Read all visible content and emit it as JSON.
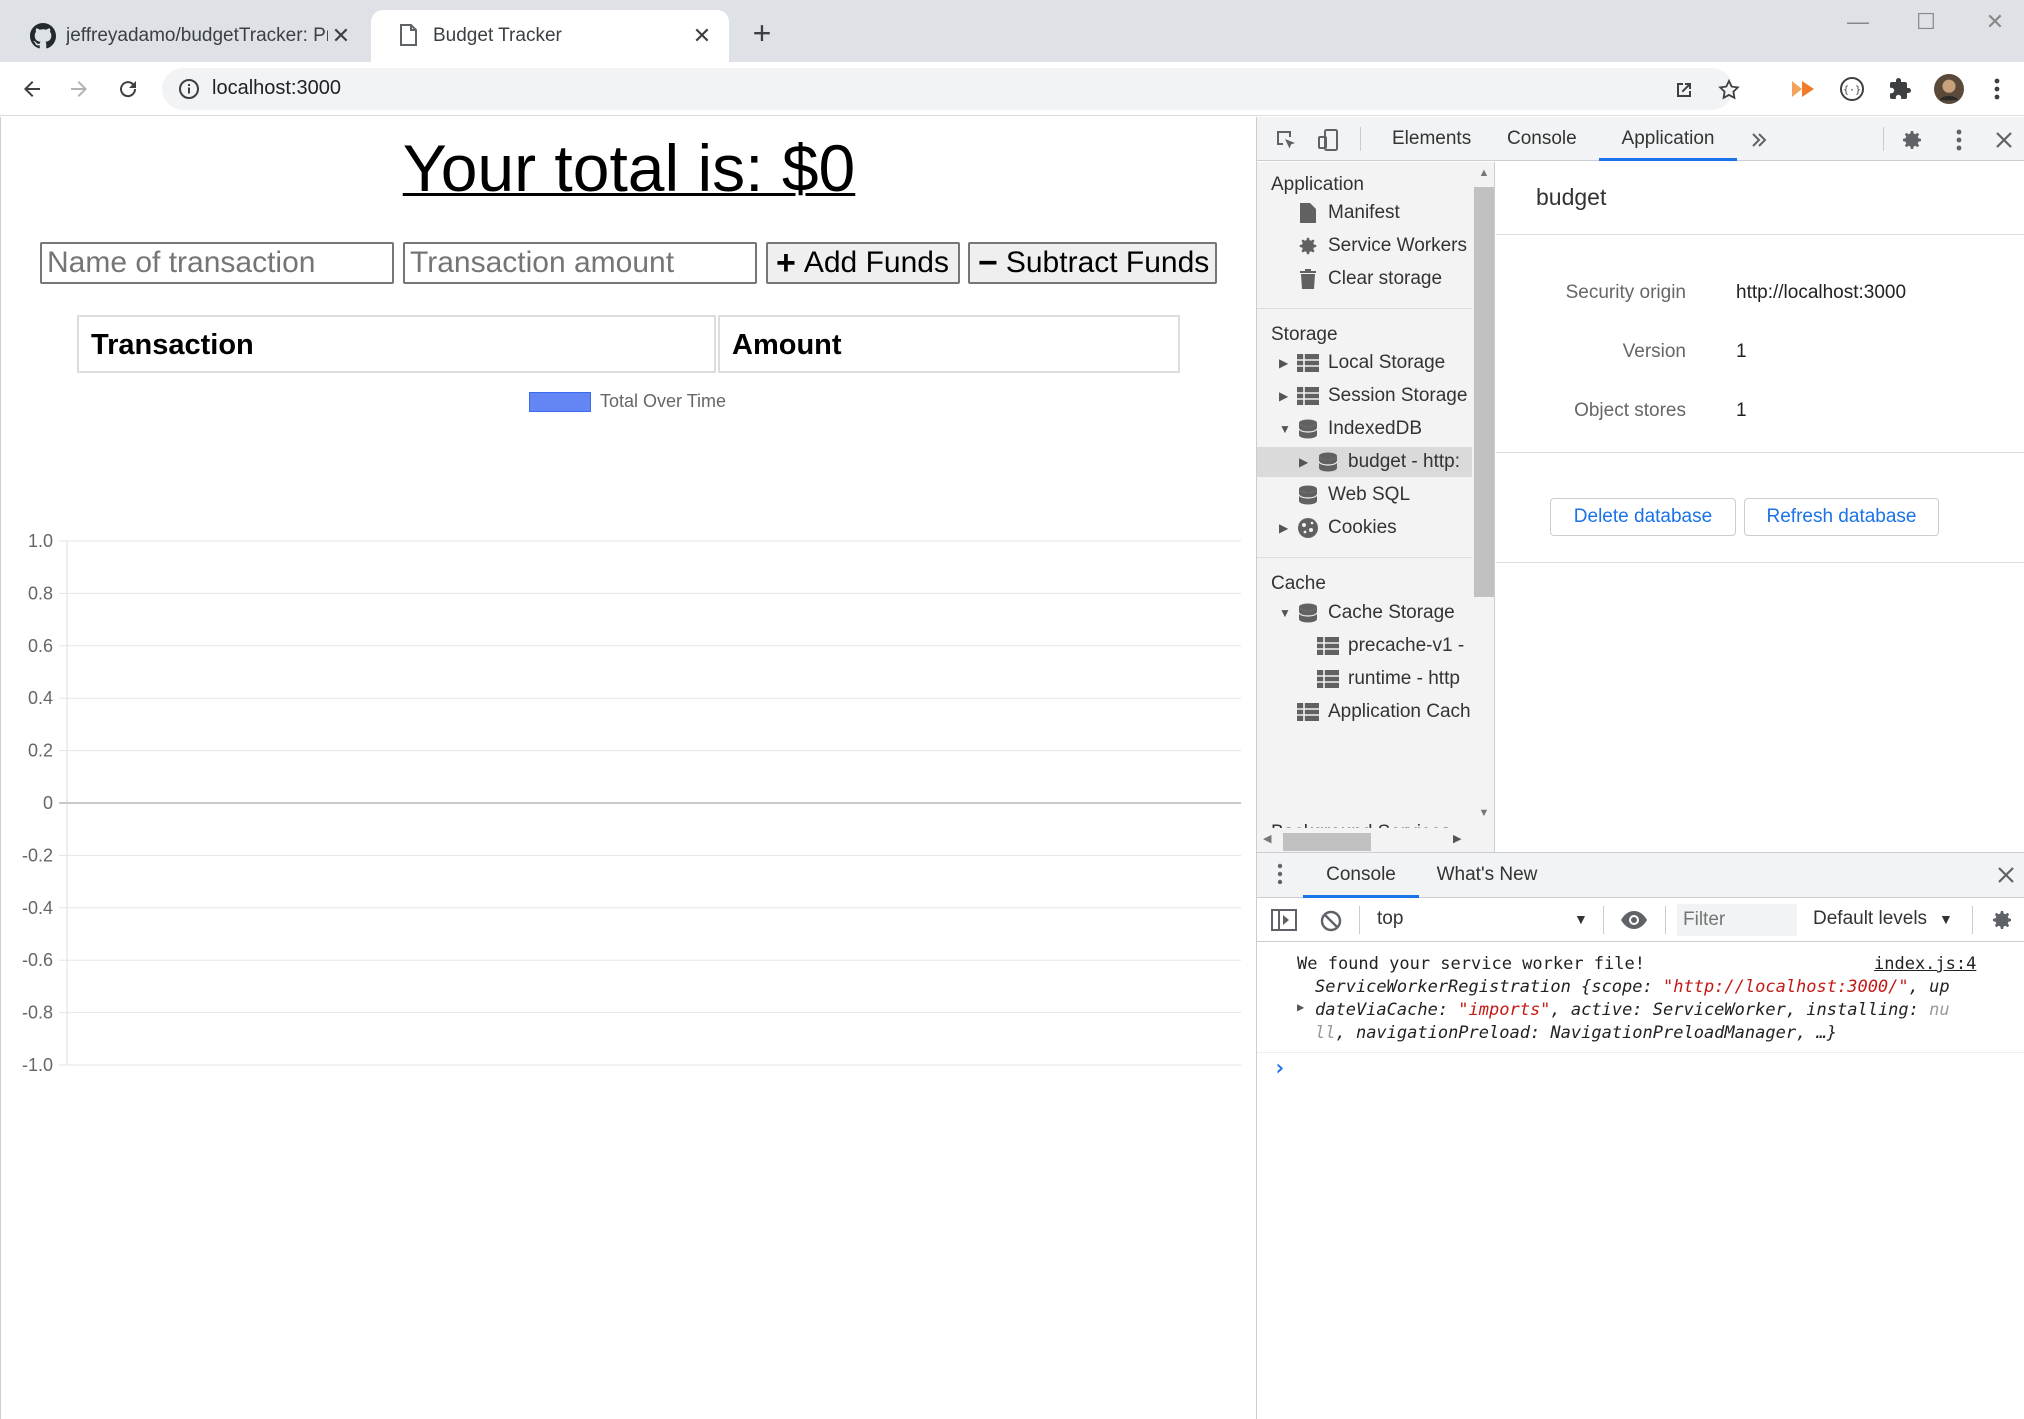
{
  "tabs": [
    {
      "title": "jeffreyadamo/budgetTracker: Pro",
      "favicon": "github-icon"
    },
    {
      "title": "Budget Tracker",
      "favicon": "document-icon"
    }
  ],
  "address": {
    "url": "localhost:3000"
  },
  "page": {
    "total_text": "Your total is: $0",
    "name_placeholder": "Name of transaction",
    "amount_placeholder": "Transaction amount",
    "add_label": "Add Funds",
    "subtract_label": "Subtract Funds",
    "table_headers": [
      "Transaction",
      "Amount"
    ]
  },
  "chart_data": {
    "type": "line",
    "series": [
      {
        "name": "Total Over Time",
        "values": [],
        "color": "#6486f5"
      }
    ],
    "x": [],
    "ylim": [
      -1.0,
      1.0
    ],
    "yticks": [
      "1.0",
      "0.8",
      "0.6",
      "0.4",
      "0.2",
      "0",
      "-0.2",
      "-0.4",
      "-0.6",
      "-0.8",
      "-1.0"
    ],
    "grid": true,
    "legend_position": "top"
  },
  "devtools": {
    "tabs": [
      "Elements",
      "Console",
      "Application"
    ],
    "active_tab": "Application",
    "sidebar": {
      "application_header": "Application",
      "application_items": [
        "Manifest",
        "Service Workers",
        "Clear storage"
      ],
      "storage_header": "Storage",
      "storage_items": [
        "Local Storage",
        "Session Storage",
        "IndexedDB",
        "budget - http:",
        "Web SQL",
        "Cookies"
      ],
      "cache_header": "Cache",
      "cache_items": [
        "Cache Storage",
        "precache-v1 -",
        "runtime - http",
        "Application Cach"
      ],
      "bg_header": "Background Services"
    },
    "main": {
      "db_name": "budget",
      "security_origin_label": "Security origin",
      "security_origin": "http://localhost:3000",
      "version_label": "Version",
      "version": "1",
      "object_stores_label": "Object stores",
      "object_stores": "1",
      "delete_label": "Delete database",
      "refresh_label": "Refresh database"
    },
    "drawer": {
      "tabs": [
        "Console",
        "What's New"
      ],
      "context": "top",
      "filter_placeholder": "Filter",
      "levels": "Default levels",
      "log_message": "We found your service worker file!",
      "log_source": "index.js:4",
      "obj_line1_a": "ServiceWorkerRegistration {scope: ",
      "obj_line1_str": "\"http://localhost:3000/\"",
      "obj_line1_b": ", up",
      "obj_line2_a": "dateViaCache: ",
      "obj_line2_str": "\"imports\"",
      "obj_line2_b": ", active: ServiceWorker, installing: ",
      "obj_line2_c": "nu",
      "obj_line3_a": "ll",
      "obj_line3_b": ", navigationPreload: NavigationPreloadManager, …}",
      "prompt": "›"
    }
  },
  "colors": {
    "accent": "#1a73e8",
    "chart_line": "#6486f5"
  }
}
